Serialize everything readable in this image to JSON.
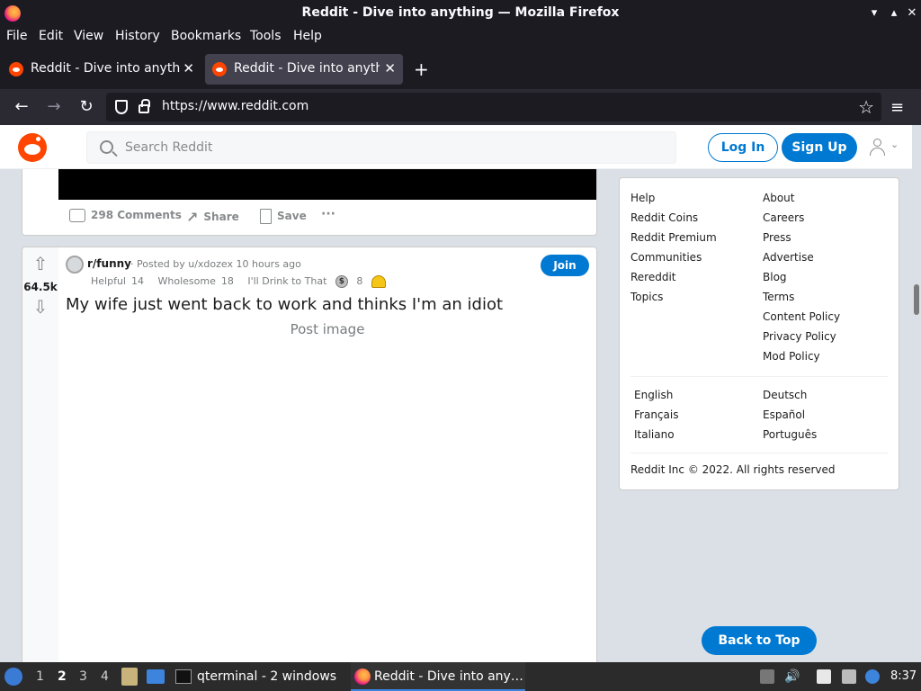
{
  "window": {
    "title": "Reddit - Dive into anything — Mozilla Firefox",
    "minimize": "▾",
    "maximize": "▴",
    "close": "✕"
  },
  "menubar": [
    "File",
    "Edit",
    "View",
    "History",
    "Bookmarks",
    "Tools",
    "Help"
  ],
  "tabs": [
    {
      "label": "Reddit - Dive into anything",
      "active": false
    },
    {
      "label": "Reddit - Dive into anything",
      "active": true
    }
  ],
  "newtab": "+",
  "nav": {
    "back": "←",
    "forward": "→",
    "reload": "↻",
    "url": "https://www.reddit.com",
    "star": "☆",
    "menu": "≡"
  },
  "reddit": {
    "search_placeholder": "Search Reddit",
    "login": "Log In",
    "signup": "Sign Up",
    "chevron": "⌄",
    "post1": {
      "comments": "298 Comments",
      "share": "Share",
      "save": "Save",
      "more": "···"
    },
    "post2": {
      "votes": "64.5k",
      "subreddit": "r/funny",
      "posted_by": "· Posted by u/xdozex 10 hours ago",
      "join": "Join",
      "awards": [
        {
          "name": "Helpful",
          "count": "14"
        },
        {
          "name": "Wholesome",
          "count": "18"
        },
        {
          "name": "I'll Drink to That",
          "count": ""
        }
      ],
      "silver_symbol": "$",
      "silver_count": "8",
      "title": "My wife just went back to work and thinks I'm an idiot",
      "image_alt": "Post image"
    },
    "sidebar": {
      "col1": [
        "Help",
        "Reddit Coins",
        "Reddit Premium",
        "Communities",
        "Rereddit",
        "Topics"
      ],
      "col2": [
        "About",
        "Careers",
        "Press",
        "Advertise",
        "Blog",
        "Terms",
        "Content Policy",
        "Privacy Policy",
        "Mod Policy"
      ],
      "lang1": [
        "English",
        "Français",
        "Italiano"
      ],
      "lang2": [
        "Deutsch",
        "Español",
        "Português"
      ],
      "copyright": "Reddit Inc © 2022. All rights reserved"
    },
    "back_to_top": "Back to Top"
  },
  "taskbar": {
    "workspaces": [
      "1",
      "2",
      "3",
      "4"
    ],
    "active_workspace": "2",
    "tasks": [
      "qterminal - 2 windows",
      "Reddit - Dive into any…"
    ],
    "clock": "8:37"
  },
  "colors": {
    "reddit_blue": "#0079d3",
    "reddit_orange": "#ff4500",
    "page_bg": "#dae0e6",
    "firefox_dark": "#1c1b22"
  }
}
